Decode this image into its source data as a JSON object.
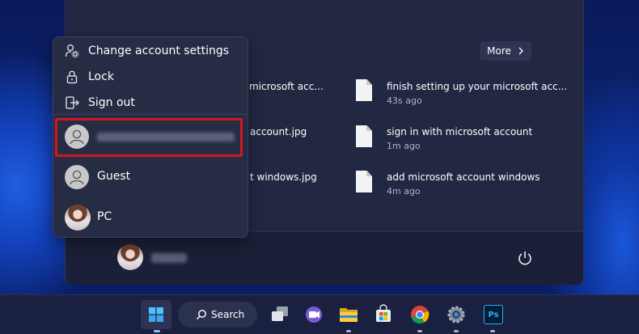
{
  "start_menu": {
    "more_label": "More",
    "recommended": [
      {
        "name": "microsoft acc...",
        "time": ""
      },
      {
        "name": "finish setting up your microsoft acc...",
        "time": "43s ago"
      },
      {
        "name": "account.jpg",
        "time": ""
      },
      {
        "name": "sign in with microsoft account",
        "time": "1m ago"
      },
      {
        "name": "t windows.jpg",
        "time": ""
      },
      {
        "name": "add microsoft account windows",
        "time": "4m ago"
      }
    ]
  },
  "account_flyout": {
    "items": [
      {
        "label": "Change account settings",
        "icon": "account-settings-icon"
      },
      {
        "label": "Lock",
        "icon": "lock-icon"
      },
      {
        "label": "Sign out",
        "icon": "sign-out-icon"
      }
    ],
    "accounts": [
      {
        "label": "",
        "avatar": "generic-user-icon",
        "highlighted": true
      },
      {
        "label": "Guest",
        "avatar": "generic-user-icon"
      },
      {
        "label": "PC",
        "avatar": "anime-avatar"
      }
    ],
    "highlight_color": "#d0171f"
  },
  "taskbar": {
    "search_label": "Search",
    "apps": [
      "start-icon",
      "search-icon",
      "task-view-icon",
      "teams-chat-icon",
      "file-explorer-icon",
      "microsoft-store-icon",
      "chrome-icon",
      "settings-icon",
      "photoshop-icon"
    ],
    "photoshop_text": "Ps"
  }
}
